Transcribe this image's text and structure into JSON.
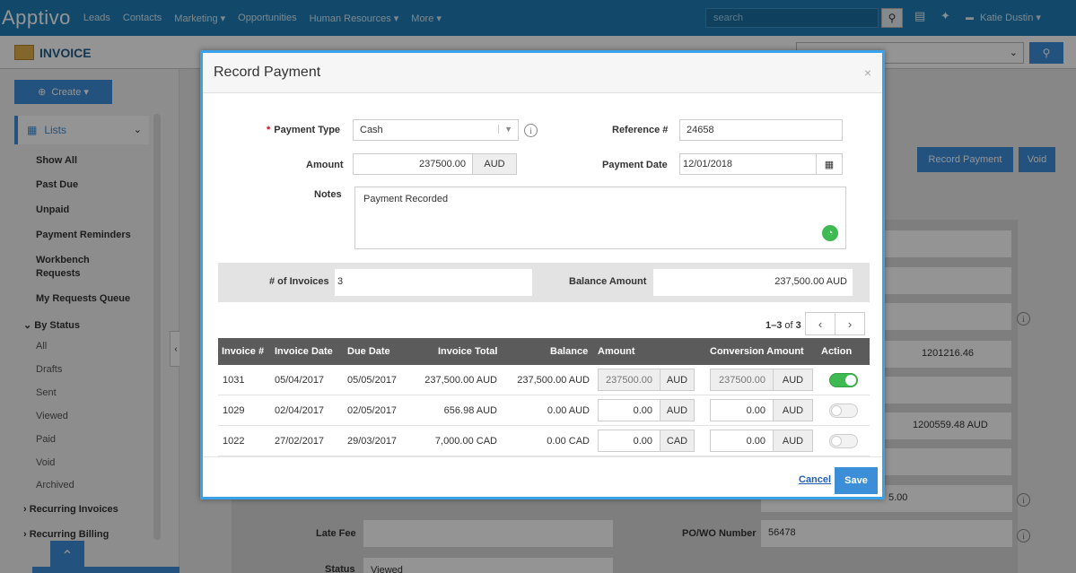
{
  "app": {
    "logo": "Apptivo",
    "nav": [
      "Leads",
      "Contacts",
      "Marketing ▾",
      "Opportunities",
      "Human Resources ▾",
      "More ▾"
    ],
    "search_placeholder": "search",
    "user": "Katie Dustin ▾"
  },
  "page": {
    "title": "INVOICE"
  },
  "sidebar": {
    "create_label": "Create ▾",
    "lists_label": "Lists",
    "items": [
      "Show All",
      "Past Due",
      "Unpaid",
      "Payment Reminders",
      "Workbench Requests",
      "My Requests Queue"
    ],
    "by_status_label": "By Status",
    "statuses": [
      "All",
      "Drafts",
      "Sent",
      "Viewed",
      "Paid",
      "Void",
      "Archived"
    ],
    "recurring_invoices": "Recurring Invoices",
    "recurring_billing": "Recurring Billing"
  },
  "background": {
    "record_payment_btn": "Record Payment",
    "void_btn": "Void",
    "value_1": "1201216.46",
    "value_2": "1200559.48  AUD",
    "value_3": "5.00",
    "late_fee_label": "Late Fee",
    "po_label": "PO/WO Number",
    "po_value": "56478",
    "status_label": "Status",
    "status_value": "Viewed"
  },
  "modal": {
    "title": "Record Payment",
    "close": "×",
    "payment_type_label": "Payment Type",
    "payment_type_value": "Cash",
    "reference_label": "Reference #",
    "reference_value": "24658",
    "amount_label": "Amount",
    "amount_value": "237500.00",
    "amount_currency": "AUD",
    "payment_date_label": "Payment Date",
    "payment_date_value": "12/01/2018",
    "notes_label": "Notes",
    "notes_value": "Payment Recorded",
    "num_invoices_label": "# of Invoices",
    "num_invoices_value": "3",
    "balance_amount_label": "Balance Amount",
    "balance_amount_value": "237,500.00 AUD",
    "pager_range": "1–3",
    "pager_of": "of",
    "pager_total": "3",
    "columns": [
      "Invoice #",
      "Invoice Date",
      "Due Date",
      "Invoice Total",
      "Balance",
      "Amount",
      "Conversion Amount",
      "Action"
    ],
    "rows": [
      {
        "num": "1031",
        "inv_date": "05/04/2017",
        "due_date": "05/05/2017",
        "total": "237,500.00 AUD",
        "balance": "237,500.00 AUD",
        "amount": "237500.00",
        "amount_cur": "AUD",
        "conv": "237500.00",
        "conv_cur": "AUD",
        "enabled": true
      },
      {
        "num": "1029",
        "inv_date": "02/04/2017",
        "due_date": "02/05/2017",
        "total": "656.98 AUD",
        "balance": "0.00 AUD",
        "amount": "0.00",
        "amount_cur": "AUD",
        "conv": "0.00",
        "conv_cur": "AUD",
        "enabled": false
      },
      {
        "num": "1022",
        "inv_date": "27/02/2017",
        "due_date": "29/03/2017",
        "total": "7,000.00 CAD",
        "balance": "0.00 CAD",
        "amount": "0.00",
        "amount_cur": "CAD",
        "conv": "0.00",
        "conv_cur": "AUD",
        "enabled": false
      }
    ],
    "cancel_label": "Cancel",
    "save_label": "Save"
  },
  "colors": {
    "brand": "#1f7fb9",
    "accent": "#3c8ed8",
    "toggle_on": "#3fb951"
  }
}
